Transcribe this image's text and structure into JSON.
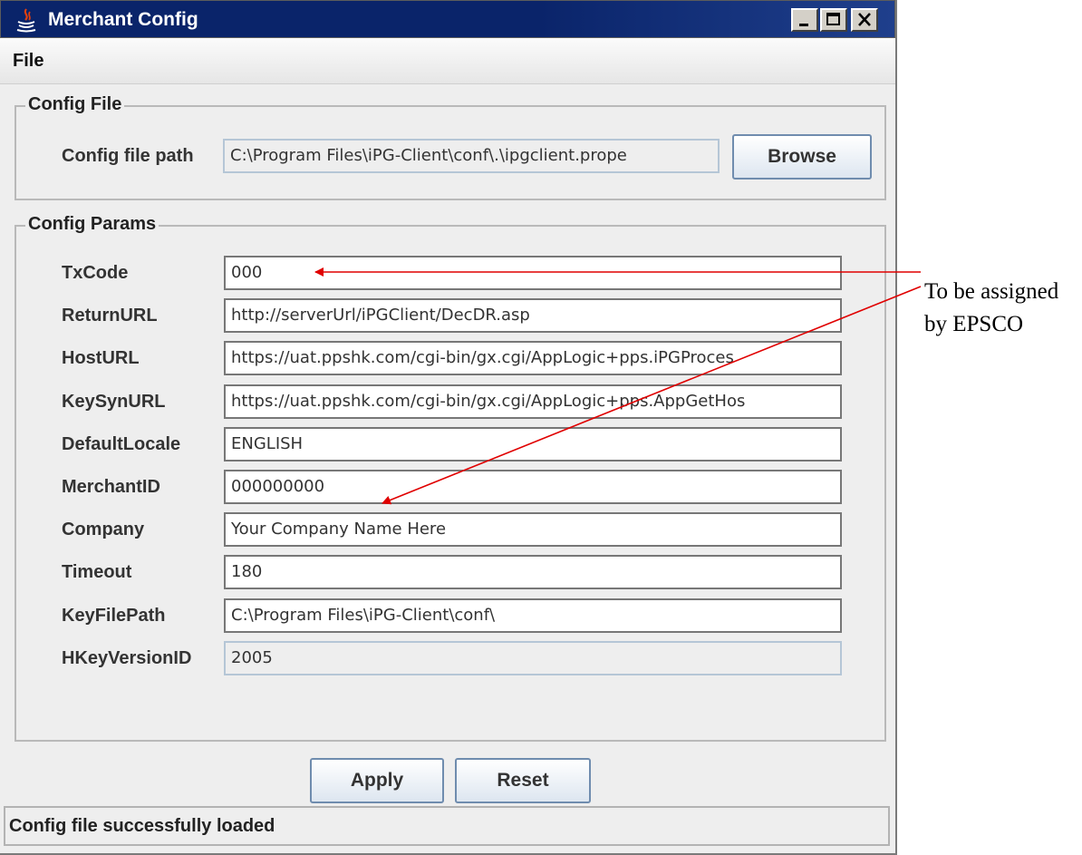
{
  "window": {
    "title": "Merchant Config",
    "controls": [
      "minimize",
      "maximize",
      "close"
    ]
  },
  "menu": {
    "file": "File"
  },
  "config_file": {
    "group_title": "Config File",
    "path_label": "Config file path",
    "path_value": "C:\\Program Files\\iPG-Client\\conf\\.\\ipgclient.prope",
    "browse_label": "Browse"
  },
  "config_params": {
    "group_title": "Config Params",
    "params": [
      {
        "label": "TxCode",
        "value": "000",
        "editable": true
      },
      {
        "label": "ReturnURL",
        "value": "http://serverUrl/iPGClient/DecDR.asp",
        "editable": true
      },
      {
        "label": "HostURL",
        "value": "https://uat.ppshk.com/cgi-bin/gx.cgi/AppLogic+pps.iPGProces",
        "editable": true
      },
      {
        "label": "KeySynURL",
        "value": "https://uat.ppshk.com/cgi-bin/gx.cgi/AppLogic+pps.AppGetHos",
        "editable": true
      },
      {
        "label": "DefaultLocale",
        "value": "ENGLISH",
        "editable": true
      },
      {
        "label": "MerchantID",
        "value": "000000000",
        "editable": true
      },
      {
        "label": "Company",
        "value": "Your Company Name Here",
        "editable": true
      },
      {
        "label": "Timeout",
        "value": "180",
        "editable": true
      },
      {
        "label": "KeyFilePath",
        "value": "C:\\Program Files\\iPG-Client\\conf\\",
        "editable": true
      },
      {
        "label": "HKeyVersionID",
        "value": "2005",
        "editable": false
      }
    ]
  },
  "actions": {
    "apply": "Apply",
    "reset": "Reset"
  },
  "status": "Config file successfully loaded",
  "annotation": {
    "text": "To be assigned by EPSCO",
    "color": "#e00000"
  },
  "colors": {
    "titlebar": "#0a246a",
    "annotation_arrow": "#e00000"
  }
}
